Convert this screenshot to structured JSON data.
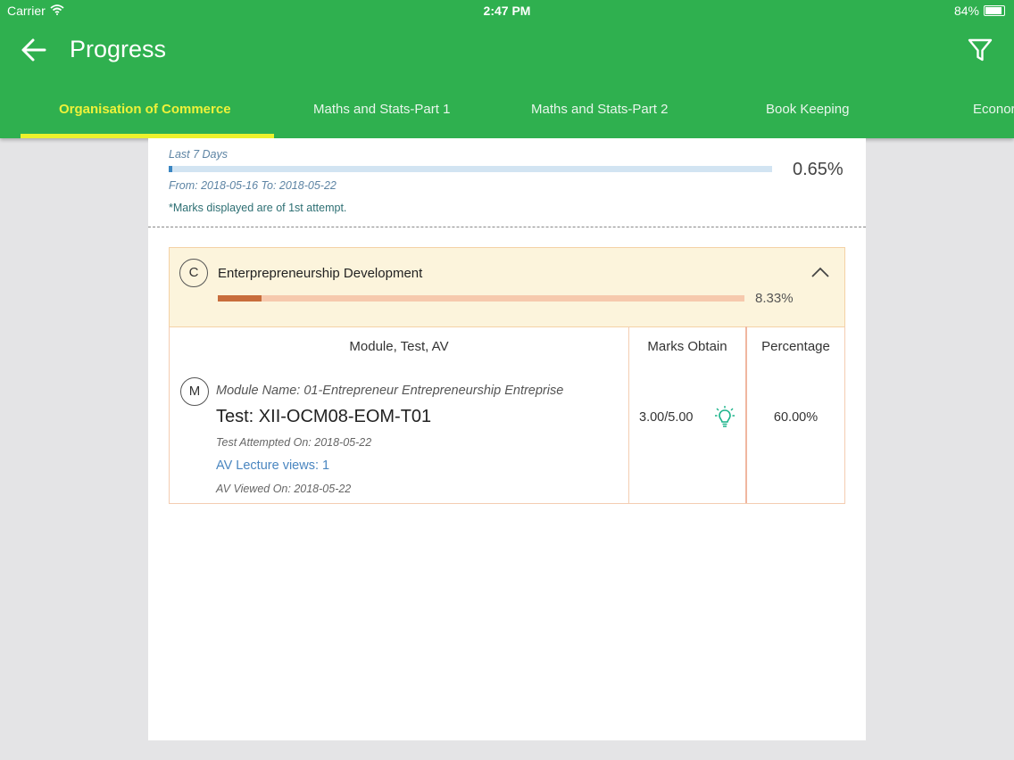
{
  "status_bar": {
    "carrier": "Carrier",
    "time": "2:47 PM",
    "battery": "84%",
    "battery_level": 0.84
  },
  "header": {
    "title": "Progress"
  },
  "tabs": [
    {
      "label": "Organisation of Commerce",
      "active": true
    },
    {
      "label": "Maths and Stats-Part 1",
      "active": false
    },
    {
      "label": "Maths and Stats-Part 2",
      "active": false
    },
    {
      "label": "Book Keeping",
      "active": false
    },
    {
      "label": "Econor",
      "active": false
    }
  ],
  "summary": {
    "period_label": "Last 7 Days",
    "progress_percent": 0.65,
    "progress_text": "0.65%",
    "date_range": "From: 2018-05-16 To: 2018-05-22",
    "note": "*Marks displayed are of 1st attempt."
  },
  "subject": {
    "badge": "C",
    "name": "Enterprepreneurship Development",
    "progress_percent": 8.33,
    "progress_text": "8.33%"
  },
  "table": {
    "headers": [
      "Module, Test, AV",
      "Marks Obtain",
      "Percentage"
    ],
    "rows": [
      {
        "badge": "M",
        "module_name": "Module Name: 01-Entrepreneur Entrepreneurship Entreprise",
        "test_name": "Test: XII-OCM08-EOM-T01",
        "attempted_on": "Test Attempted On: 2018-05-22",
        "av_views": "AV Lecture views: 1",
        "av_viewed_on": "AV Viewed On: 2018-05-22",
        "marks": "3.00/5.00",
        "percentage": "60.00%"
      }
    ]
  },
  "colors": {
    "header_bg": "#2fb04f",
    "active_tab": "#eef23a",
    "summary_bar": "#3a86c2",
    "subject_bar": "#c86d3c",
    "bulb_icon": "#1bb38a"
  },
  "icons": [
    "wifi-icon",
    "battery-icon",
    "back-arrow-icon",
    "filter-icon",
    "chevron-up-icon",
    "lightbulb-icon"
  ]
}
